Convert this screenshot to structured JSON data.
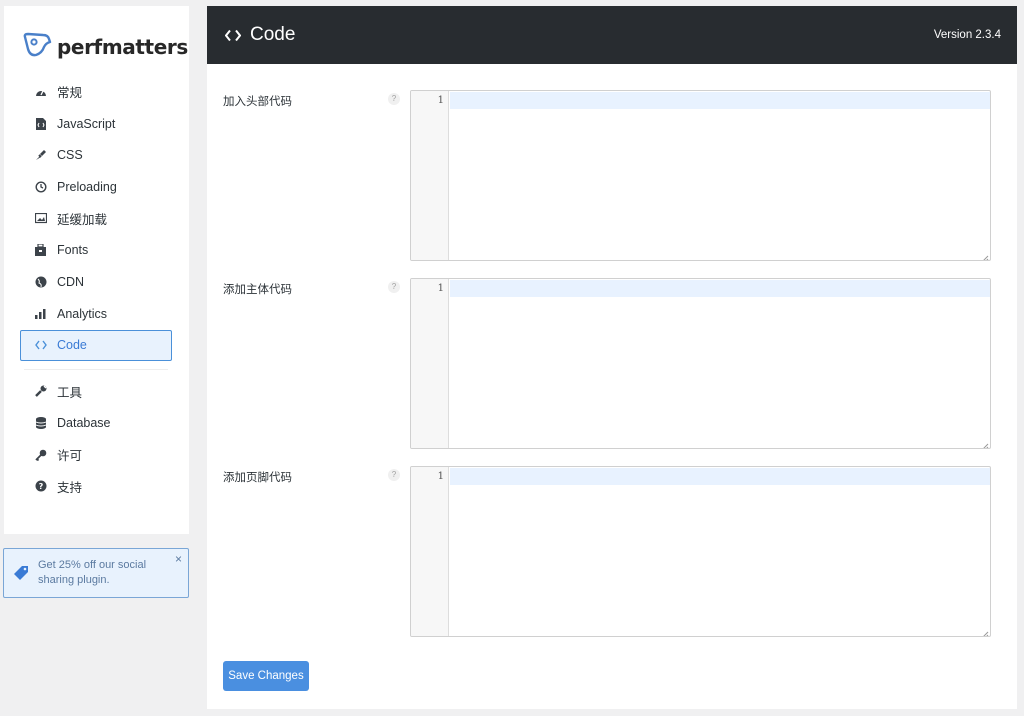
{
  "brand": {
    "name": "perfmatters",
    "accent": "#4a90d9"
  },
  "sidebar": {
    "items": [
      {
        "label": "常规",
        "icon": "dashboard-icon"
      },
      {
        "label": "JavaScript",
        "icon": "file-code-icon"
      },
      {
        "label": "CSS",
        "icon": "paintbrush-icon"
      },
      {
        "label": "Preloading",
        "icon": "clock-icon"
      },
      {
        "label": "延缓加载",
        "icon": "image-icon"
      },
      {
        "label": "Fonts",
        "icon": "toolbox-icon"
      },
      {
        "label": "CDN",
        "icon": "globe-icon"
      },
      {
        "label": "Analytics",
        "icon": "bar-chart-icon"
      },
      {
        "label": "Code",
        "icon": "code-icon",
        "active": true
      }
    ],
    "secondary_items": [
      {
        "label": "工具",
        "icon": "wrench-icon"
      },
      {
        "label": "Database",
        "icon": "database-icon"
      },
      {
        "label": "许可",
        "icon": "key-icon"
      },
      {
        "label": "支持",
        "icon": "question-circle-icon"
      }
    ]
  },
  "promo": {
    "text": "Get 25% off our social sharing plugin.",
    "close": "×"
  },
  "header": {
    "title": "Code",
    "version": "Version 2.3.4"
  },
  "fields": [
    {
      "label": "加入头部代码",
      "tooltip": "?",
      "line_number": "1",
      "value": ""
    },
    {
      "label": "添加主体代码",
      "tooltip": "?",
      "line_number": "1",
      "value": ""
    },
    {
      "label": "添加页脚代码",
      "tooltip": "?",
      "line_number": "1",
      "value": ""
    }
  ],
  "save_button": "Save Changes"
}
